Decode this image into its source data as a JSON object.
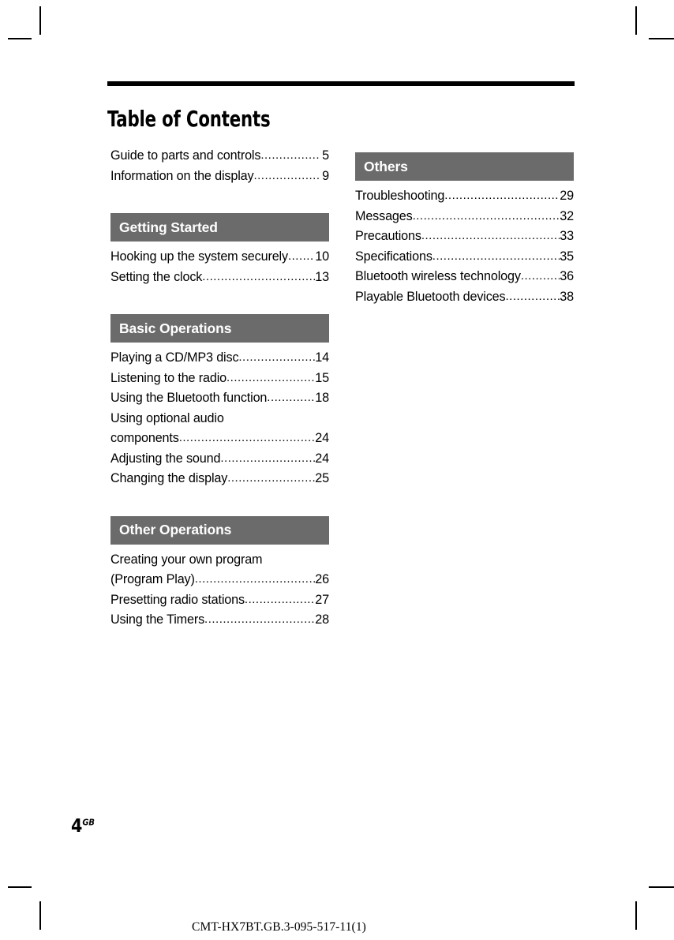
{
  "document": {
    "title": "Table of Contents",
    "folio_number": "4",
    "folio_region": "GB",
    "model_code": "CMT-HX7BT.GB.3-095-517-11(1)"
  },
  "colors": {
    "section_bar_bg": "#6b6b6b",
    "section_bar_text": "#ffffff",
    "rule": "#000000",
    "body_text": "#000000",
    "page_bg": "#ffffff"
  },
  "toc": {
    "left_column": [
      {
        "type": "entries",
        "items": [
          {
            "label": "Guide to parts and controls",
            "page": "5"
          },
          {
            "label": "Information on the display",
            "page": "9"
          }
        ]
      },
      {
        "type": "section",
        "heading": "Getting Started",
        "items": [
          {
            "label": "Hooking up the system securely",
            "page": "10"
          },
          {
            "label": "Setting the clock",
            "page": "13"
          }
        ]
      },
      {
        "type": "section",
        "heading": "Basic Operations",
        "items": [
          {
            "label": "Playing a CD/MP3 disc",
            "page": "14"
          },
          {
            "label": "Listening to the radio",
            "page": "15"
          },
          {
            "label": "Using the Bluetooth function",
            "page": "18"
          },
          {
            "label": "Using optional audio",
            "label2": "components",
            "page": "24"
          },
          {
            "label": "Adjusting the sound",
            "page": "24"
          },
          {
            "label": "Changing the display",
            "page": "25"
          }
        ]
      },
      {
        "type": "section",
        "heading": "Other Operations",
        "items": [
          {
            "label": "Creating your own program",
            "label2": "(Program Play)",
            "page": "26"
          },
          {
            "label": "Presetting radio stations",
            "page": "27"
          },
          {
            "label": "Using the Timers",
            "page": "28"
          }
        ]
      }
    ],
    "right_column": [
      {
        "type": "section",
        "heading": "Others",
        "items": [
          {
            "label": "Troubleshooting",
            "page": "29"
          },
          {
            "label": "Messages",
            "page": "32"
          },
          {
            "label": "Precautions",
            "page": "33"
          },
          {
            "label": "Specifications",
            "page": "35"
          },
          {
            "label": "Bluetooth wireless technology",
            "page": "36"
          },
          {
            "label": "Playable Bluetooth devices",
            "page": "38"
          }
        ]
      }
    ]
  }
}
